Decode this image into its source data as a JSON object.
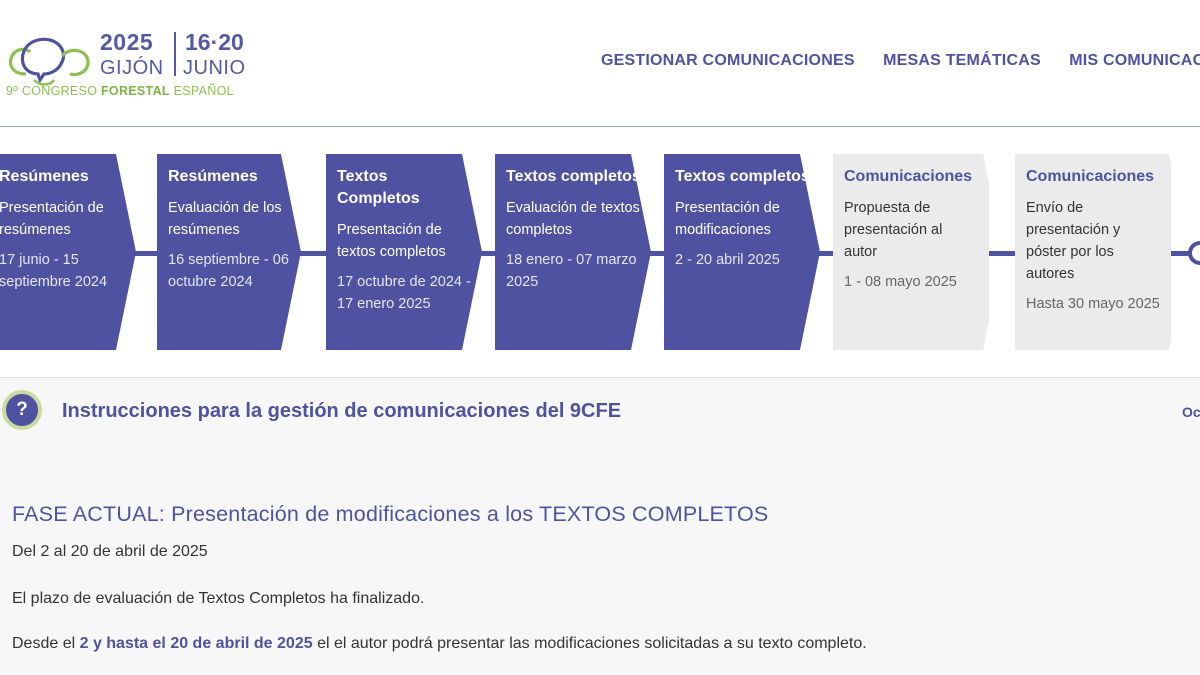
{
  "logo": {
    "year": "2025",
    "city": "GIJÓN",
    "dates": "16·20",
    "month": "JUNIO",
    "sub_prefix": "9º CONGRESO",
    "sub_bold": "FORESTAL",
    "sub_suffix": "ESPAÑOL"
  },
  "nav": {
    "items": [
      "GESTIONAR COMUNICACIONES",
      "MESAS TEMÁTICAS",
      "MIS COMUNICACIONES"
    ]
  },
  "timeline": {
    "steps": [
      {
        "title": "Resúmenes",
        "desc": "Presentación de resúmenes",
        "date": " 17 junio - 15 septiembre 2024",
        "status": "done"
      },
      {
        "title": "Resúmenes",
        "desc": "Evaluación de los resúmenes",
        "date": " 16 septiembre -  06  octubre 2024",
        "status": "done"
      },
      {
        "title": "Textos Completos",
        "desc": "Presentación de textos completos",
        "date": "17 octubre de 2024 - 17 enero 2025",
        "status": "done"
      },
      {
        "title": "Textos completos",
        "desc": "Evaluación de textos completos",
        "date": "18 enero - 07 marzo 2025",
        "status": "done"
      },
      {
        "title": "Textos completos",
        "desc": "Presentación de modificaciones",
        "date": "2 - 20 abril 2025",
        "status": "done"
      },
      {
        "title": "Comunicaciones",
        "desc": "Propuesta de presentación al autor",
        "date": "1 - 08 mayo 2025",
        "status": "todo"
      },
      {
        "title": "Comunicaciones",
        "desc": "Envío de presentación y póster por los autores",
        "date": "Hasta 30 mayo 2025",
        "status": "todo"
      }
    ],
    "colors": {
      "done": "#4f52a0",
      "todo": "#ebebeb"
    }
  },
  "info": {
    "icon_glyph": "?",
    "title": "Instrucciones para la gestión de comunicaciones del 9CFE",
    "right_text": "Oc"
  },
  "phase": {
    "title": "FASE ACTUAL: Presentación de modificaciones a los TEXTOS COMPLETOS",
    "dates": "Del 2 al 20 de  abril de 2025",
    "status": "El plazo de evaluación  de Textos Completos ha finalizado.",
    "detail_prefix": "Desde el ",
    "detail_bold": "2 y hasta el 20 de abril de 2025",
    "detail_suffix": " el el autor podrá presentar las modificaciones solicitadas a su texto completo."
  }
}
